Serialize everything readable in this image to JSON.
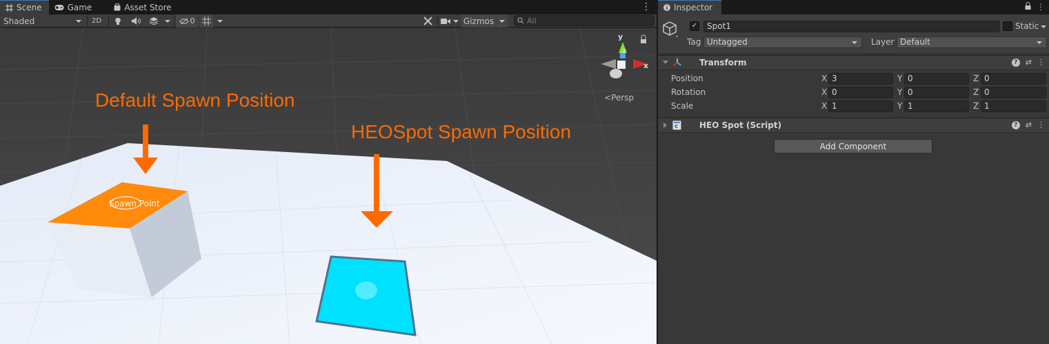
{
  "scene_tabs": [
    {
      "label": "Scene",
      "icon": "scene-grid-icon"
    },
    {
      "label": "Game",
      "icon": "gamepad-icon"
    },
    {
      "label": "Asset Store",
      "icon": "shopping-bag-icon"
    }
  ],
  "toolbar": {
    "draw_mode": "Shaded",
    "mode_2d": "2D",
    "hidden_count": "0",
    "gizmos": "Gizmos",
    "search_placeholder": "All"
  },
  "viewport": {
    "annotation_default": "Default Spawn Position",
    "annotation_heospot": "HEOSpot Spawn Position",
    "spawn_point_label": "Spawn Point",
    "projection": "Persp",
    "gizmo_axes": {
      "y": "y",
      "x": "x",
      "z": "z"
    },
    "annotation_color": "#ff6a00",
    "floor_color": "#eef2fb",
    "box_top_color": "#ff8a0c",
    "spot_color": "#00e1ff"
  },
  "inspector": {
    "tab_label": "Inspector",
    "object_name": "Spot1",
    "active": true,
    "static_label": "Static",
    "tag_label": "Tag",
    "tag_value": "Untagged",
    "layer_label": "Layer",
    "layer_value": "Default",
    "transform": {
      "title": "Transform",
      "rows": [
        {
          "label": "Position",
          "x": "3",
          "y": "0",
          "z": "0"
        },
        {
          "label": "Rotation",
          "x": "0",
          "y": "0",
          "z": "0"
        },
        {
          "label": "Scale",
          "x": "1",
          "y": "1",
          "z": "1"
        }
      ]
    },
    "script_component": {
      "title": "HEO Spot (Script)"
    },
    "add_component": "Add Component",
    "axis_labels": {
      "x": "X",
      "y": "Y",
      "z": "Z"
    }
  }
}
